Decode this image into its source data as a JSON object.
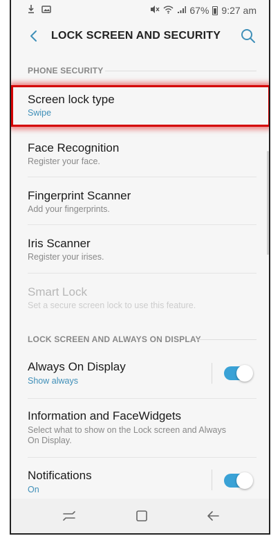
{
  "status_bar": {
    "battery_percent": "67%",
    "time": "9:27 am"
  },
  "header": {
    "title": "LOCK SCREEN AND SECURITY"
  },
  "sections": {
    "phone_security": "PHONE SECURITY",
    "lock_screen": "LOCK SCREEN AND ALWAYS ON DISPLAY"
  },
  "items": [
    {
      "title": "Screen lock type",
      "subtitle": "Swipe"
    },
    {
      "title": "Face Recognition",
      "subtitle": "Register your face."
    },
    {
      "title": "Fingerprint Scanner",
      "subtitle": "Add your fingerprints."
    },
    {
      "title": "Iris Scanner",
      "subtitle": "Register your irises."
    },
    {
      "title": "Smart Lock",
      "subtitle": "Set a secure screen lock to use this feature."
    },
    {
      "title": "Always On Display",
      "subtitle": "Show always",
      "toggle": true
    },
    {
      "title": "Information and FaceWidgets",
      "subtitle_line1": "Select what to show on the Lock screen and Always",
      "subtitle_line2": "On Display."
    },
    {
      "title": "Notifications",
      "subtitle": "On",
      "toggle": true
    }
  ],
  "colors": {
    "accent": "#3f8fb8",
    "highlight": "#d40000",
    "toggle_on": "#3aa2d6"
  }
}
